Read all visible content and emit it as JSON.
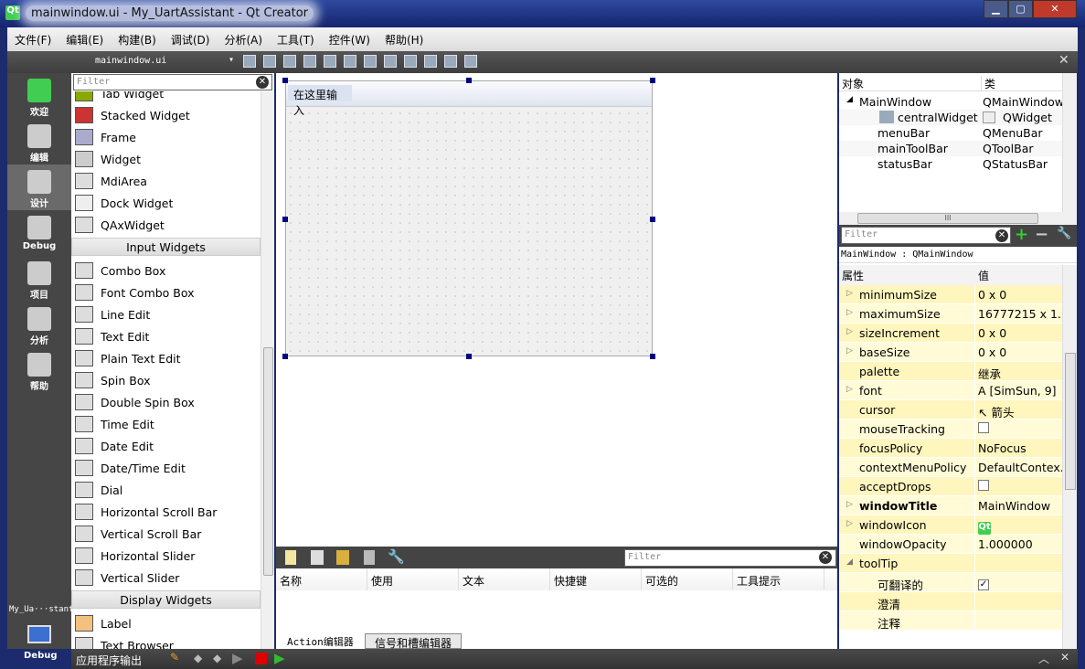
{
  "window": {
    "title": "mainwindow.ui - My_UartAssistant - Qt Creator",
    "app_icon": "Qt",
    "controls": [
      "minimize",
      "maximize",
      "close"
    ]
  },
  "menu": [
    "文件(F)",
    "编辑(E)",
    "构建(B)",
    "调试(D)",
    "分析(A)",
    "工具(T)",
    "控件(W)",
    "帮助(H)"
  ],
  "toolbar": {
    "file": "mainwindow.ui",
    "icons": [
      "edit-widgets",
      "edit-signals-slots",
      "edit-buddies",
      "edit-tab-order",
      "layout-horizontal",
      "layout-vertical",
      "splitter-horizontal",
      "splitter-vertical",
      "layout-form",
      "layout-grid",
      "break-layout",
      "adjust-size"
    ]
  },
  "modes": [
    {
      "label": "欢迎",
      "icon": "qt-icon"
    },
    {
      "label": "编辑",
      "icon": "edit-icon"
    },
    {
      "label": "设计",
      "icon": "design-icon"
    },
    {
      "label": "Debug",
      "icon": "debug-icon"
    },
    {
      "label": "项目",
      "icon": "project-icon"
    },
    {
      "label": "分析",
      "icon": "analyze-icon"
    },
    {
      "label": "帮助",
      "icon": "help-icon"
    }
  ],
  "kit": {
    "project": "My_Ua···stant",
    "build": "Debug"
  },
  "widgetbox": {
    "filter_placeholder": "Filter",
    "items": [
      "Tab Widget",
      "Stacked Widget",
      "Frame",
      "Widget",
      "MdiArea",
      "Dock Widget",
      "QAxWidget"
    ],
    "cat_input": "Input Widgets",
    "input_items": [
      "Combo Box",
      "Font Combo Box",
      "Line Edit",
      "Text Edit",
      "Plain Text Edit",
      "Spin Box",
      "Double Spin Box",
      "Time Edit",
      "Date Edit",
      "Date/Time Edit",
      "Dial",
      "Horizontal Scroll Bar",
      "Vertical Scroll Bar",
      "Horizontal Slider",
      "Vertical Slider"
    ],
    "cat_display": "Display Widgets",
    "display_items": [
      "Label",
      "Text Browser"
    ]
  },
  "form": {
    "menu_placeholder": "在这里输入"
  },
  "action_editor": {
    "filter_placeholder": "Filter",
    "columns": [
      "名称",
      "使用",
      "文本",
      "快捷键",
      "可选的",
      "工具提示"
    ],
    "tabs": [
      "Action编辑器",
      "信号和槽编辑器"
    ]
  },
  "object_inspector": {
    "columns": [
      "对象",
      "类"
    ],
    "rows": [
      {
        "object": "MainWindow",
        "class": "QMainWindow"
      },
      {
        "object": "centralWidget",
        "class": "QWidget"
      },
      {
        "object": "menuBar",
        "class": "QMenuBar"
      },
      {
        "object": "mainToolBar",
        "class": "QToolBar"
      },
      {
        "object": "statusBar",
        "class": "QStatusBar"
      }
    ]
  },
  "property_editor": {
    "filter_placeholder": "Filter",
    "object_label": "MainWindow : QMainWindow",
    "columns": [
      "属性",
      "值"
    ],
    "rows": [
      {
        "name": "minimumSize",
        "value": "0 x 0",
        "exp": "▷"
      },
      {
        "name": "maximumSize",
        "value": "16777215 x 1...",
        "exp": "▷"
      },
      {
        "name": "sizeIncrement",
        "value": "0 x 0",
        "exp": "▷"
      },
      {
        "name": "baseSize",
        "value": "0 x 0",
        "exp": "▷"
      },
      {
        "name": "palette",
        "value": "继承",
        "exp": ""
      },
      {
        "name": "font",
        "value": "A  [SimSun, 9]",
        "exp": "▷"
      },
      {
        "name": "cursor",
        "value": "↖  箭头",
        "exp": ""
      },
      {
        "name": "mouseTracking",
        "value": "",
        "check": false,
        "exp": ""
      },
      {
        "name": "focusPolicy",
        "value": "NoFocus",
        "exp": ""
      },
      {
        "name": "contextMenuPolicy",
        "value": "DefaultContex...",
        "exp": ""
      },
      {
        "name": "acceptDrops",
        "value": "",
        "check": false,
        "exp": ""
      },
      {
        "name": "windowTitle",
        "value": "MainWindow",
        "exp": "▷",
        "bold": true
      },
      {
        "name": "windowIcon",
        "value": "",
        "exp": "▷"
      },
      {
        "name": "windowOpacity",
        "value": "1.000000",
        "exp": ""
      },
      {
        "name": "toolTip",
        "value": "",
        "exp": "◢"
      },
      {
        "name": "可翻译的",
        "value": "",
        "check": true,
        "exp": "",
        "sub": true
      },
      {
        "name": "澄清",
        "value": "",
        "exp": "",
        "sub": true
      },
      {
        "name": "注释",
        "value": "",
        "exp": "",
        "sub": true
      }
    ]
  },
  "output": {
    "label": "应用程序输出"
  }
}
